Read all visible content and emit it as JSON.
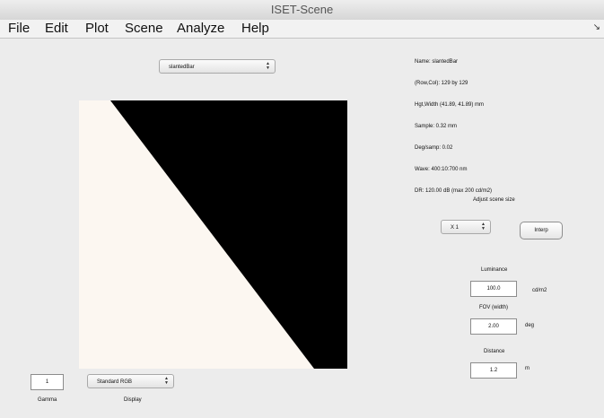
{
  "window": {
    "title": "ISET-Scene"
  },
  "menu": [
    {
      "label": "File"
    },
    {
      "label": "Edit"
    },
    {
      "label": "Plot"
    },
    {
      "label": "Scene"
    },
    {
      "label": "Analyze"
    },
    {
      "label": "Help"
    }
  ],
  "scene_select": {
    "value": "slantedBar"
  },
  "info_lines": [
    "Name: slantedBar",
    "(Row,Col): 129 by 129",
    "Hgt,Width (41.89, 41.89) mm",
    "Sample: 0.32 mm",
    "Deg/samp: 0.02",
    "Wave: 400:10:700 nm",
    "DR: 120.00 dB (max 200 cd/m2)"
  ],
  "adjust_size": {
    "label": "Adjust scene size",
    "select_value": "X 1",
    "button_label": "Interp"
  },
  "luminance": {
    "label": "Luminance",
    "value": "100.0",
    "unit": "cd/m2"
  },
  "fov": {
    "label": "FOV (width)",
    "value": "2.00",
    "unit": "deg"
  },
  "distance": {
    "label": "Distance",
    "value": "1.2",
    "unit": "m"
  },
  "gamma": {
    "value": "1",
    "label": "Gamma"
  },
  "display": {
    "value": "Standard RGB",
    "label": "Display"
  },
  "colors": {
    "background": "#ececec",
    "image_light": "#fcf7f1",
    "image_dark": "#000000"
  }
}
